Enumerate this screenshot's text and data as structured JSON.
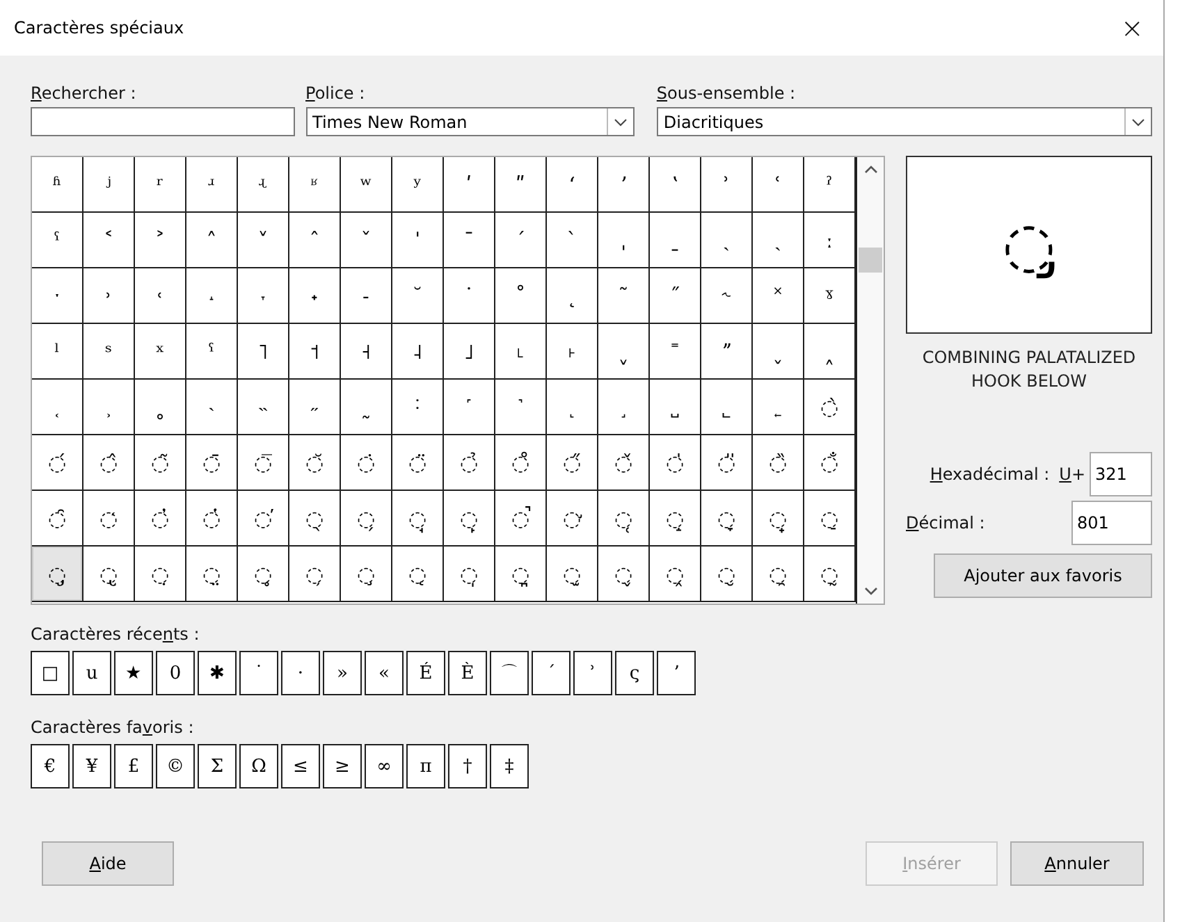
{
  "window": {
    "title": "Caractères spéciaux",
    "close": "×"
  },
  "search": {
    "label": {
      "key": "R",
      "post": "echercher :"
    }
  },
  "font": {
    "label": {
      "key": "P",
      "post": "olice :"
    },
    "value": "Times New Roman"
  },
  "subset": {
    "label": {
      "key": "S",
      "post": "ous-ensemble :"
    },
    "value": "Diacritiques"
  },
  "grid": {
    "rows": [
      {
        "cells": [
          {
            "char": "ʱ",
            "selected": false
          },
          {
            "char": "ʲ",
            "selected": false
          },
          {
            "char": "ʳ",
            "selected": false
          },
          {
            "char": "ʴ",
            "selected": false
          },
          {
            "char": "ʵ",
            "selected": false
          },
          {
            "char": "ʶ",
            "selected": false
          },
          {
            "char": "ʷ",
            "selected": false
          },
          {
            "char": "ʸ",
            "selected": false
          },
          {
            "char": "ʹ",
            "selected": false
          },
          {
            "char": "ʺ",
            "selected": false
          },
          {
            "char": "ʻ",
            "selected": false
          },
          {
            "char": "ʼ",
            "selected": false
          },
          {
            "char": "ʽ",
            "selected": false
          },
          {
            "char": "ʾ",
            "selected": false
          },
          {
            "char": "ʿ",
            "selected": false
          },
          {
            "char": "ˀ",
            "selected": false
          }
        ]
      },
      {
        "cells": [
          {
            "char": "ˁ",
            "selected": false
          },
          {
            "char": "˂",
            "selected": false
          },
          {
            "char": "˃",
            "selected": false
          },
          {
            "char": "˄",
            "selected": false
          },
          {
            "char": "˅",
            "selected": false
          },
          {
            "char": "ˆ",
            "selected": false
          },
          {
            "char": "ˇ",
            "selected": false
          },
          {
            "char": "ˈ",
            "selected": false
          },
          {
            "char": "ˉ",
            "selected": false
          },
          {
            "char": "ˊ",
            "selected": false
          },
          {
            "char": "ˋ",
            "selected": false
          },
          {
            "char": "ˌ",
            "selected": false
          },
          {
            "char": "ˍ",
            "selected": false
          },
          {
            "char": "ˎ",
            "selected": false
          },
          {
            "char": "ˏ",
            "selected": false
          },
          {
            "char": "ː",
            "selected": false
          }
        ]
      },
      {
        "cells": [
          {
            "char": "ˑ",
            "selected": false
          },
          {
            "char": "˒",
            "selected": false
          },
          {
            "char": "˓",
            "selected": false
          },
          {
            "char": "˔",
            "selected": false
          },
          {
            "char": "˕",
            "selected": false
          },
          {
            "char": "˖",
            "selected": false
          },
          {
            "char": "˗",
            "selected": false
          },
          {
            "char": "˘",
            "selected": false
          },
          {
            "char": "˙",
            "selected": false
          },
          {
            "char": "˚",
            "selected": false
          },
          {
            "char": "˛",
            "selected": false
          },
          {
            "char": "˜",
            "selected": false
          },
          {
            "char": "˝",
            "selected": false
          },
          {
            "char": "˞",
            "selected": false
          },
          {
            "char": "˟",
            "selected": false
          },
          {
            "char": "ˠ",
            "selected": false
          }
        ]
      },
      {
        "cells": [
          {
            "char": "ˡ",
            "selected": false
          },
          {
            "char": "ˢ",
            "selected": false
          },
          {
            "char": "ˣ",
            "selected": false
          },
          {
            "char": "ˤ",
            "selected": false
          },
          {
            "char": "˥",
            "selected": false
          },
          {
            "char": "˦",
            "selected": false
          },
          {
            "char": "˧",
            "selected": false
          },
          {
            "char": "˨",
            "selected": false
          },
          {
            "char": "˩",
            "selected": false
          },
          {
            "char": "˪",
            "selected": false
          },
          {
            "char": "˫",
            "selected": false
          },
          {
            "char": "ˬ",
            "selected": false
          },
          {
            "char": "˭",
            "selected": false
          },
          {
            "char": "ˮ",
            "selected": false
          },
          {
            "char": "˯",
            "selected": false
          },
          {
            "char": "˰",
            "selected": false
          }
        ]
      },
      {
        "cells": [
          {
            "char": "˱",
            "selected": false
          },
          {
            "char": "˲",
            "selected": false
          },
          {
            "char": "˳",
            "selected": false
          },
          {
            "char": "˴",
            "selected": false
          },
          {
            "char": "˵",
            "selected": false
          },
          {
            "char": "˶",
            "selected": false
          },
          {
            "char": "˷",
            "selected": false
          },
          {
            "char": "˸",
            "selected": false
          },
          {
            "char": "˹",
            "selected": false
          },
          {
            "char": "˺",
            "selected": false
          },
          {
            "char": "˻",
            "selected": false
          },
          {
            "char": "˼",
            "selected": false
          },
          {
            "char": "˽",
            "selected": false
          },
          {
            "char": "˾",
            "selected": false
          },
          {
            "char": "˿",
            "selected": false
          },
          {
            "char": "◌̀",
            "selected": false
          }
        ]
      },
      {
        "cells": [
          {
            "char": "◌́",
            "selected": false
          },
          {
            "char": "◌̂",
            "selected": false
          },
          {
            "char": "◌̃",
            "selected": false
          },
          {
            "char": "◌̄",
            "selected": false
          },
          {
            "char": "◌̅",
            "selected": false
          },
          {
            "char": "◌̆",
            "selected": false
          },
          {
            "char": "◌̇",
            "selected": false
          },
          {
            "char": "◌̈",
            "selected": false
          },
          {
            "char": "◌̉",
            "selected": false
          },
          {
            "char": "◌̊",
            "selected": false
          },
          {
            "char": "◌̋",
            "selected": false
          },
          {
            "char": "◌̌",
            "selected": false
          },
          {
            "char": "◌̍",
            "selected": false
          },
          {
            "char": "◌̎",
            "selected": false
          },
          {
            "char": "◌̏",
            "selected": false
          },
          {
            "char": "◌̐",
            "selected": false
          }
        ]
      },
      {
        "cells": [
          {
            "char": "◌̑",
            "selected": false
          },
          {
            "char": "◌̒",
            "selected": false
          },
          {
            "char": "◌̓",
            "selected": false
          },
          {
            "char": "◌̔",
            "selected": false
          },
          {
            "char": "◌̕",
            "selected": false
          },
          {
            "char": "◌̖",
            "selected": false
          },
          {
            "char": "◌̗",
            "selected": false
          },
          {
            "char": "◌̘",
            "selected": false
          },
          {
            "char": "◌̙",
            "selected": false
          },
          {
            "char": "◌̚",
            "selected": false
          },
          {
            "char": "◌̛",
            "selected": false
          },
          {
            "char": "◌̜",
            "selected": false
          },
          {
            "char": "◌̝",
            "selected": false
          },
          {
            "char": "◌̞",
            "selected": false
          },
          {
            "char": "◌̟",
            "selected": false
          },
          {
            "char": "◌̠",
            "selected": false
          }
        ]
      },
      {
        "cells": [
          {
            "char": "◌̡",
            "selected": true
          },
          {
            "char": "◌̢",
            "selected": false
          },
          {
            "char": "◌̣",
            "selected": false
          },
          {
            "char": "◌̤",
            "selected": false
          },
          {
            "char": "◌̥",
            "selected": false
          },
          {
            "char": "◌̦",
            "selected": false
          },
          {
            "char": "◌̧",
            "selected": false
          },
          {
            "char": "◌̨",
            "selected": false
          },
          {
            "char": "◌̩",
            "selected": false
          },
          {
            "char": "◌̪",
            "selected": false
          },
          {
            "char": "◌̫",
            "selected": false
          },
          {
            "char": "◌̬",
            "selected": false
          },
          {
            "char": "◌̭",
            "selected": false
          },
          {
            "char": "◌̮",
            "selected": false
          },
          {
            "char": "◌̯",
            "selected": false
          },
          {
            "char": "◌̰",
            "selected": false
          }
        ]
      }
    ]
  },
  "preview": {
    "char": "◌̡",
    "name": "COMBINING PALATALIZED HOOK BELOW"
  },
  "hex": {
    "label": {
      "key": "H",
      "post": "exadécimal :"
    },
    "prefix": {
      "key": "U",
      "post": "+"
    },
    "value": "321"
  },
  "decimal": {
    "label": {
      "key": "D",
      "post": "écimal :"
    },
    "value": "801"
  },
  "add_favorite": "Ajouter aux favoris",
  "recent": {
    "label": {
      "pre": "Caractères réce",
      "key": "n",
      "post": "ts :"
    },
    "chars": [
      "□",
      "u",
      "★",
      "0",
      "✱",
      "˙",
      "·",
      "»",
      "«",
      "É",
      "È",
      "⌒",
      "ˊ",
      "ʾ",
      "ς",
      "ʼ"
    ]
  },
  "favorites": {
    "label": {
      "pre": "Caractères fa",
      "key": "v",
      "post": "oris :"
    },
    "chars": [
      "€",
      "¥",
      "£",
      "©",
      "Σ",
      "Ω",
      "≤",
      "≥",
      "∞",
      "π",
      "†",
      "‡"
    ]
  },
  "buttons": [
    {
      "kind": "help",
      "label": {
        "key": "A",
        "post": "ide"
      },
      "disabled": false
    },
    {
      "kind": "insert",
      "label": {
        "key": "I",
        "post": "nsérer"
      },
      "disabled": true
    },
    {
      "kind": "cancel",
      "label": {
        "key": "A",
        "post": "nnuler"
      },
      "disabled": false
    }
  ]
}
